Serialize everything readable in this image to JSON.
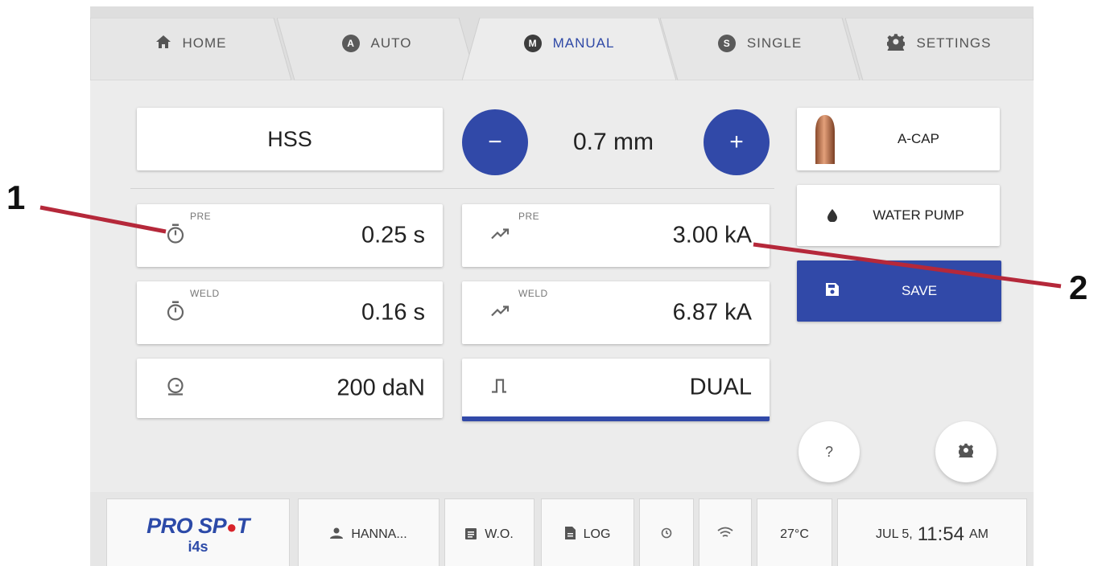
{
  "tabs": [
    {
      "label": "HOME",
      "icon": "home-icon"
    },
    {
      "label": "AUTO",
      "icon": "A"
    },
    {
      "label": "MANUAL",
      "icon": "M",
      "active": true
    },
    {
      "label": "SINGLE",
      "icon": "S"
    },
    {
      "label": "SETTINGS",
      "icon": "gear-icon"
    }
  ],
  "material": "HSS",
  "thickness": {
    "value": "0.7 mm",
    "minus": "−",
    "plus": "+"
  },
  "params": {
    "pre_time": {
      "sub": "PRE",
      "value": "0.25 s"
    },
    "weld_time": {
      "sub": "WELD",
      "value": "0.16 s"
    },
    "force": {
      "value": "200 daN"
    },
    "pre_current": {
      "sub": "PRE",
      "value": "3.00 kA"
    },
    "weld_current": {
      "sub": "WELD",
      "value": "6.87 kA"
    },
    "mode": {
      "value": "DUAL"
    }
  },
  "side": {
    "cap": "A-CAP",
    "pump": "WATER PUMP",
    "save": "SAVE"
  },
  "fabs": {
    "help": "?"
  },
  "footer": {
    "logo_top": "PRO SP",
    "logo_dot": "●",
    "logo_t": "T",
    "logo_sub": "i4s",
    "user": "HANNA...",
    "wo": "W.O.",
    "log": "LOG",
    "temp": "27°C",
    "date": "JUL 5,",
    "time": "11:54",
    "ampm": "AM"
  },
  "callouts": {
    "one": "1",
    "two": "2"
  },
  "colors": {
    "accent": "#3149a8",
    "callout_line": "#b5283a"
  }
}
